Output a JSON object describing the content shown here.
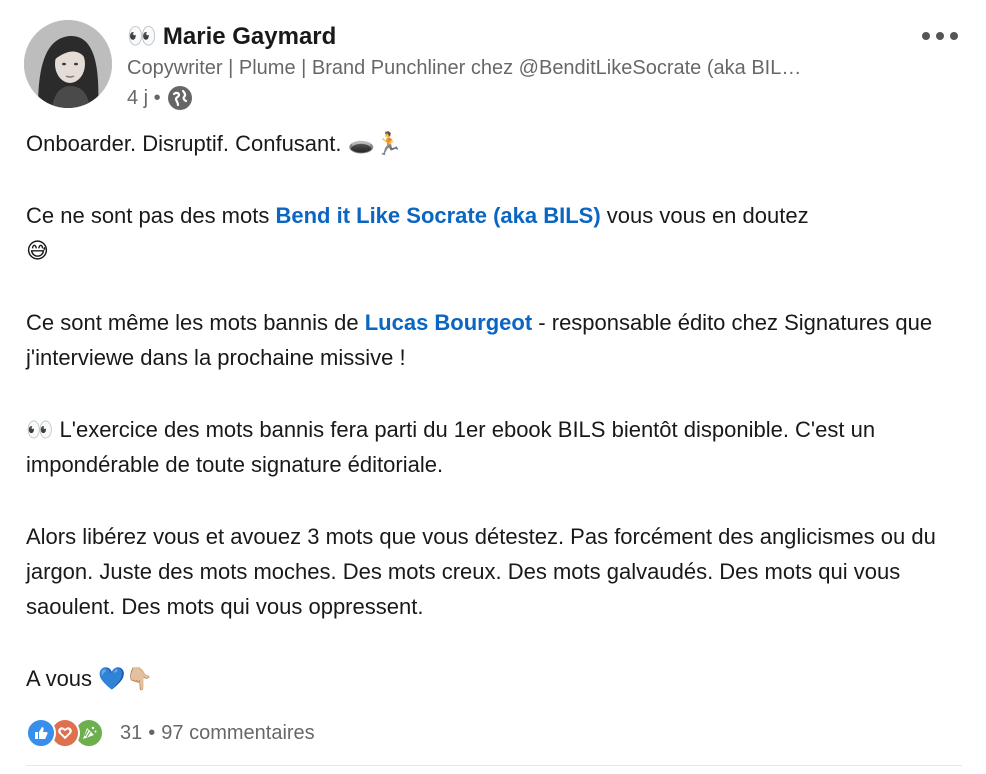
{
  "author": {
    "name_emoji": "👀",
    "name": "Marie Gaymard",
    "headline": "Copywriter | Plume | Brand Punchliner chez @BenditLikeSocrate (aka BIL…",
    "time": "4 j •"
  },
  "icons": {
    "visibility": "globe-icon",
    "more": "more-icon",
    "reactions": [
      "like-icon",
      "love-icon",
      "celebrate-icon"
    ]
  },
  "post": {
    "p1_text": "Onboarder. Disruptif. Confusant. ",
    "p1_emoji": "🕳️🏃",
    "p2_before": "Ce ne sont pas des mots ",
    "p2_mention": "Bend it Like Socrate (aka BILS)",
    "p2_after": " vous vous en doutez",
    "p2_emoji": "😅",
    "p3_before": "Ce sont même les mots bannis de ",
    "p3_mention": "Lucas Bourgeot",
    "p3_after": " - responsable édito chez Signatures que j'interviewe dans la prochaine missive !",
    "p4_emoji": "👀",
    "p4_text": " L'exercice des mots bannis fera parti du 1er ebook BILS bientôt disponible. C'est un impondérable de toute signature éditoriale.",
    "p5_text": "Alors libérez vous et avouez 3 mots que vous détestez. Pas forcément des anglicismes ou du jargon. Juste des mots moches. Des mots creux. Des mots galvaudés. Des mots qui vous saoulent. Des mots qui vous oppressent.",
    "p6_text": "A vous ",
    "p6_emoji": "💙👇🏼"
  },
  "social": {
    "reactions_count": "31",
    "separator": "•",
    "comments": "97 commentaires"
  },
  "colors": {
    "link": "#0a66c2",
    "like": "#378fe9",
    "love": "#df704d",
    "celebrate": "#6dae4f"
  }
}
